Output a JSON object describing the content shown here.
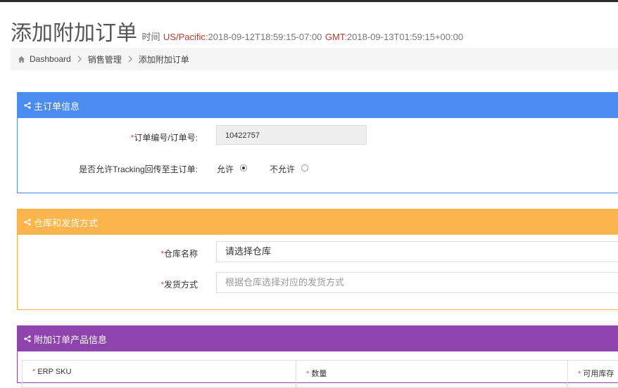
{
  "header": {
    "title": "添加附加订单",
    "time_label": "时间",
    "tz1_label": "US/Pacific",
    "tz1_value": ":2018-09-12T18:59:15-07:00",
    "tz2_label": "GMT",
    "tz2_value": ":2018-09-13T01:59:15+00:00"
  },
  "breadcrumb": {
    "items": [
      "Dashboard",
      "销售管理",
      "添加附加订单"
    ]
  },
  "main_order": {
    "title": "主订单信息",
    "order_no_label": "订单编号/订单号:",
    "order_no_value": "10422757",
    "tracking_label": "是否允许Tracking回传至主订单:",
    "allow_label": "允许",
    "disallow_label": "不允许",
    "allow_checked": true
  },
  "warehouse": {
    "title": "仓库和发货方式",
    "warehouse_label": "仓库名称",
    "warehouse_value": "请选择仓库",
    "shipping_label": "发货方式",
    "shipping_placeholder": "根据仓库选择对应的发货方式"
  },
  "products": {
    "title": "附加订单产品信息",
    "columns": [
      "ERP SKU",
      "数量",
      "可用库存"
    ]
  },
  "colors": {
    "panel_blue": "#4a8cf0",
    "panel_orange": "#fcb54c",
    "panel_purple": "#8e44ad",
    "required": "#d9534f",
    "tz_label": "#c0392b"
  },
  "icons": {
    "home": "home-icon",
    "separator": "chevron-right-icon",
    "panel": "share-icon"
  }
}
